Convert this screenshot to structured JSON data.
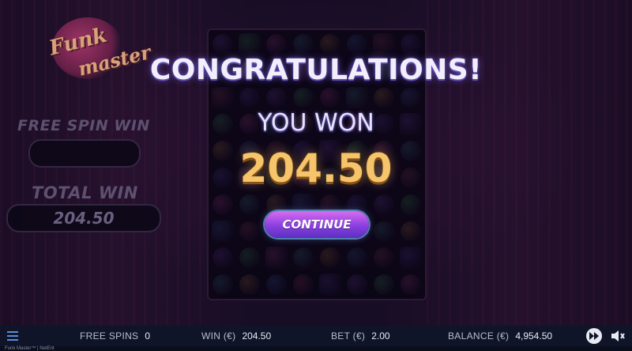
{
  "logo": {
    "line1": "Funk",
    "line2": "master"
  },
  "side_panel": {
    "free_spin_win_label": "FREE SPIN WIN",
    "free_spin_win_value": "",
    "total_win_label": "TOTAL WIN",
    "total_win_value": "204.50"
  },
  "popup": {
    "title": "CONGRATULATIONS!",
    "subtitle": "YOU WON",
    "amount": "204.50",
    "continue_label": "CONTINUE"
  },
  "status_bar": {
    "free_spins_label": "FREE SPINS",
    "free_spins_value": "0",
    "win_label": "WIN (€)",
    "win_value": "204.50",
    "bet_label": "BET (€)",
    "bet_value": "2.00",
    "balance_label": "BALANCE (€)",
    "balance_value": "4,954.50"
  },
  "footer": {
    "text": "Funk Master™ | NetEnt"
  },
  "colors": {
    "accent_gold": "#f6c46a",
    "button_purple": "#8a3fe0",
    "bar_bg": "#0f1428"
  },
  "icons": {
    "menu": "hamburger-icon",
    "fast_forward": "fast-forward-icon",
    "sound": "speaker-icon"
  }
}
